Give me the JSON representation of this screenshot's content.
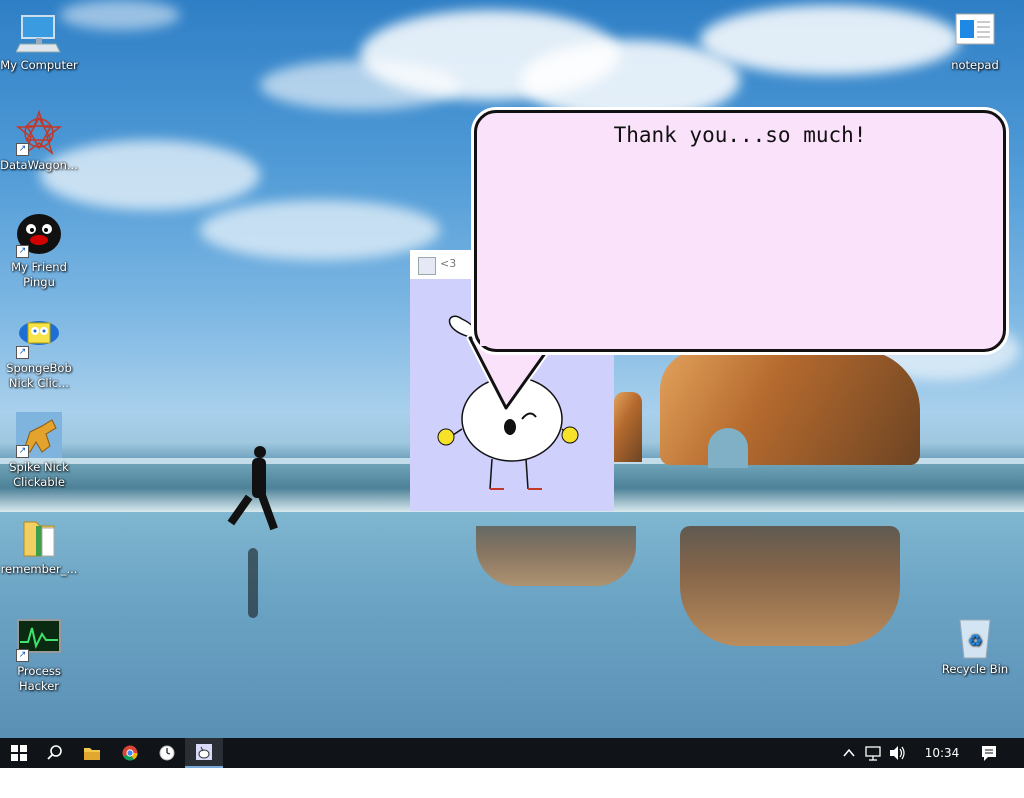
{
  "desktop": {
    "icons_left": [
      {
        "label_line1": "My Computer",
        "label_line2": ""
      },
      {
        "label_line1": "DataWagon...",
        "label_line2": ""
      },
      {
        "label_line1": "My Friend",
        "label_line2": "Pingu"
      },
      {
        "label_line1": "SpongeBob",
        "label_line2": "Nick Clic..."
      },
      {
        "label_line1": "Spike Nick",
        "label_line2": "Clickable"
      },
      {
        "label_line1": "remember_...",
        "label_line2": ""
      },
      {
        "label_line1": "Process",
        "label_line2": "Hacker"
      }
    ],
    "icons_right": [
      {
        "label_line1": "notepad",
        "label_line2": ""
      },
      {
        "label_line1": "Recycle Bin",
        "label_line2": ""
      }
    ]
  },
  "app_window": {
    "title": "<3"
  },
  "speech_bubble": {
    "text": "Thank you...so much!"
  },
  "taskbar": {
    "icons": [
      "windows-start-icon",
      "search-icon",
      "file-explorer-icon",
      "chrome-icon",
      "clock-app-icon",
      "character-app-icon"
    ],
    "clock": "10:34 AM"
  }
}
